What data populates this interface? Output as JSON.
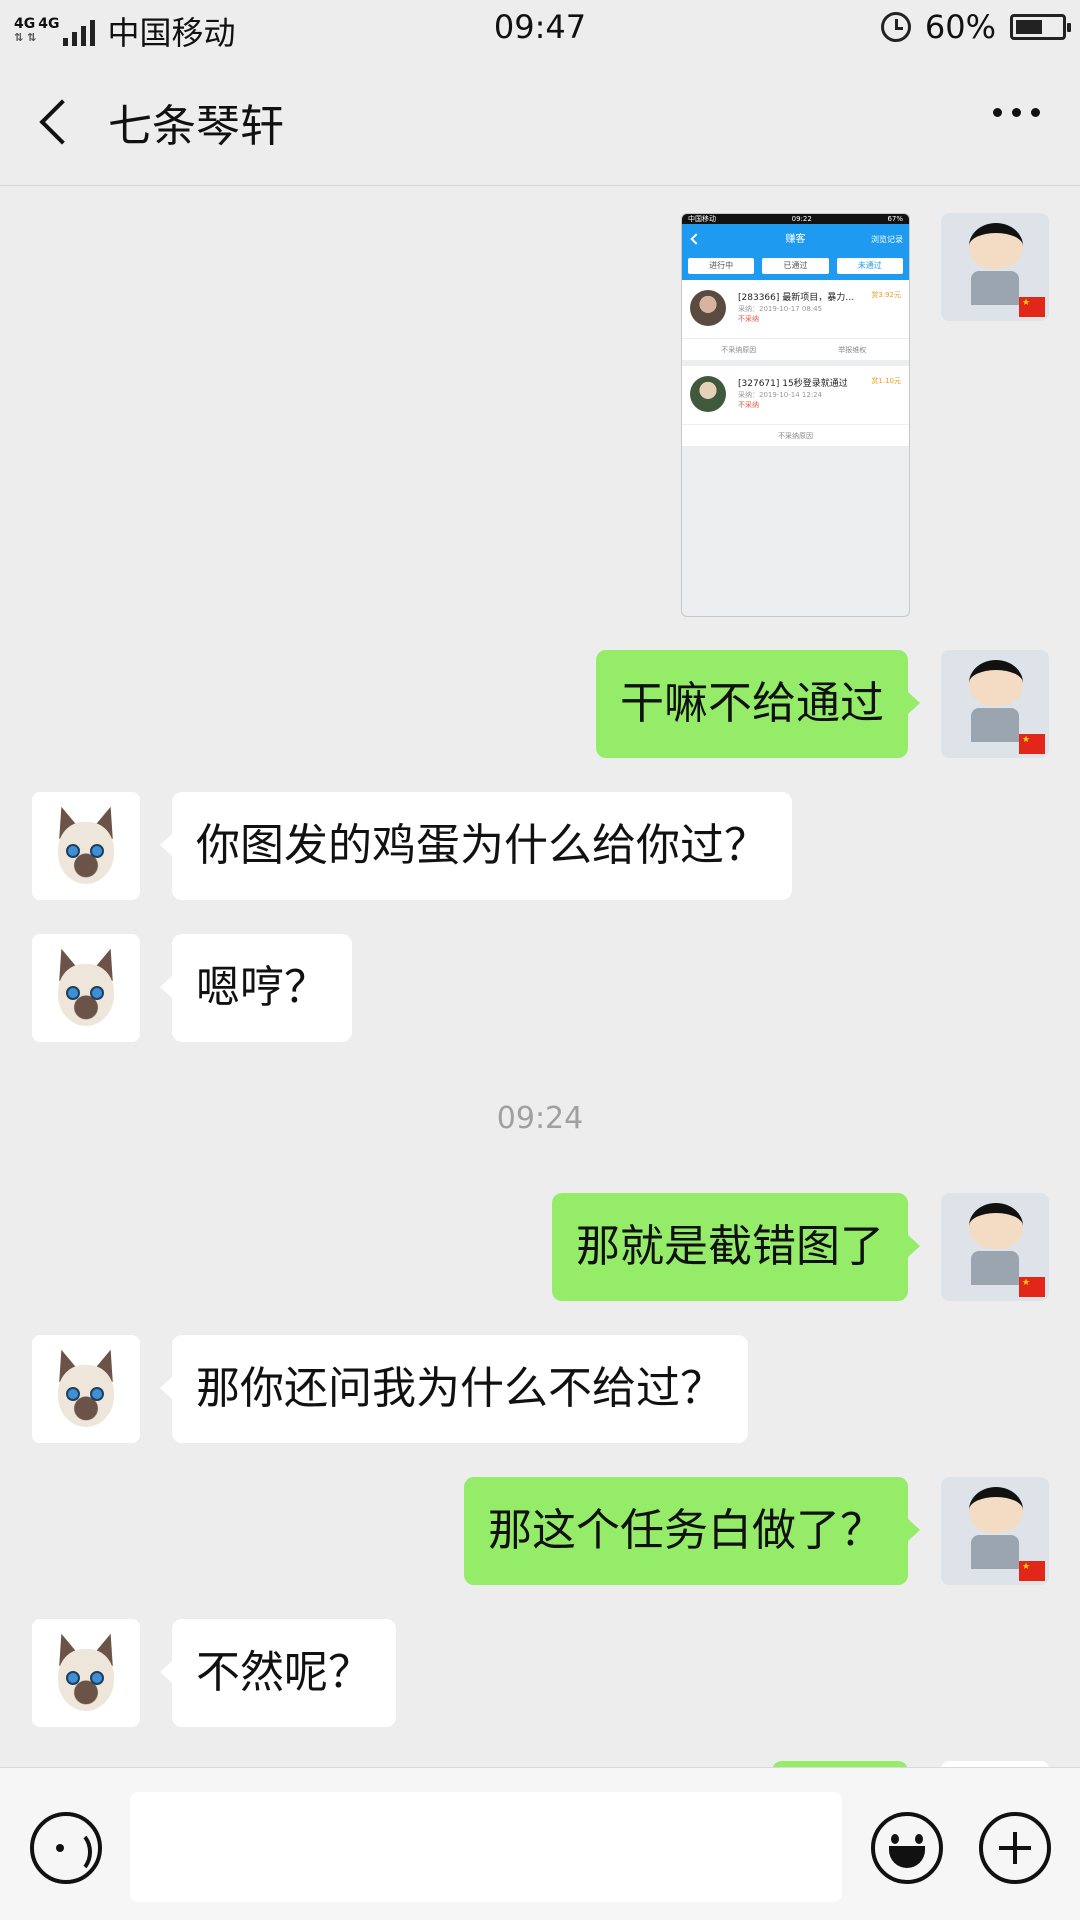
{
  "status_bar": {
    "network_a": "4G",
    "network_b": "4G",
    "carrier": "中国移动",
    "time": "09:47",
    "battery_percent": "60%",
    "battery_level": 0.6
  },
  "header": {
    "title": "七条琴轩"
  },
  "screenshot_thumb": {
    "status_left": "中国移动",
    "status_time": "09:22",
    "status_right": "67%",
    "title": "赚客",
    "right_action": "浏览记录",
    "tabs": [
      "进行中",
      "已通过",
      "未通过"
    ],
    "items": [
      {
        "title": "[283366] 最新项目，暴力…",
        "date": "采纳：2019-10-17 08:45",
        "status": "不采纳",
        "price": "赏3.92元",
        "actions": [
          "不采纳原因",
          "举报维权"
        ]
      },
      {
        "title": "[327671] 15秒登录就通过",
        "date": "采纳：2019-10-14 12:24",
        "status": "不采纳",
        "price": "赏1.10元",
        "actions": [
          "不采纳原因"
        ]
      }
    ]
  },
  "messages": [
    {
      "from": "me",
      "text": "干嘛不给通过"
    },
    {
      "from": "them",
      "text": "你图发的鸡蛋为什么给你过？"
    },
    {
      "from": "them",
      "text": "嗯哼？"
    },
    {
      "from": "me",
      "text": "那就是截错图了"
    },
    {
      "from": "them",
      "text": "那你还问我为什么不给过？"
    },
    {
      "from": "me",
      "text": "那这个任务白做了？"
    },
    {
      "from": "them",
      "text": "不然呢？"
    }
  ],
  "timestamp": "09:24",
  "input": {
    "value": "",
    "placeholder": ""
  },
  "icons": {
    "back": "back-arrow-icon",
    "more": "more-dots-icon",
    "voice": "voice-icon",
    "emoji": "emoji-icon",
    "plus": "plus-icon",
    "alarm": "alarm-icon",
    "battery": "battery-icon",
    "signal": "signal-icon"
  },
  "colors": {
    "my_bubble": "#95ec69",
    "their_bubble": "#ffffff",
    "background": "#ededed",
    "thumb_header": "#1e9af0"
  }
}
